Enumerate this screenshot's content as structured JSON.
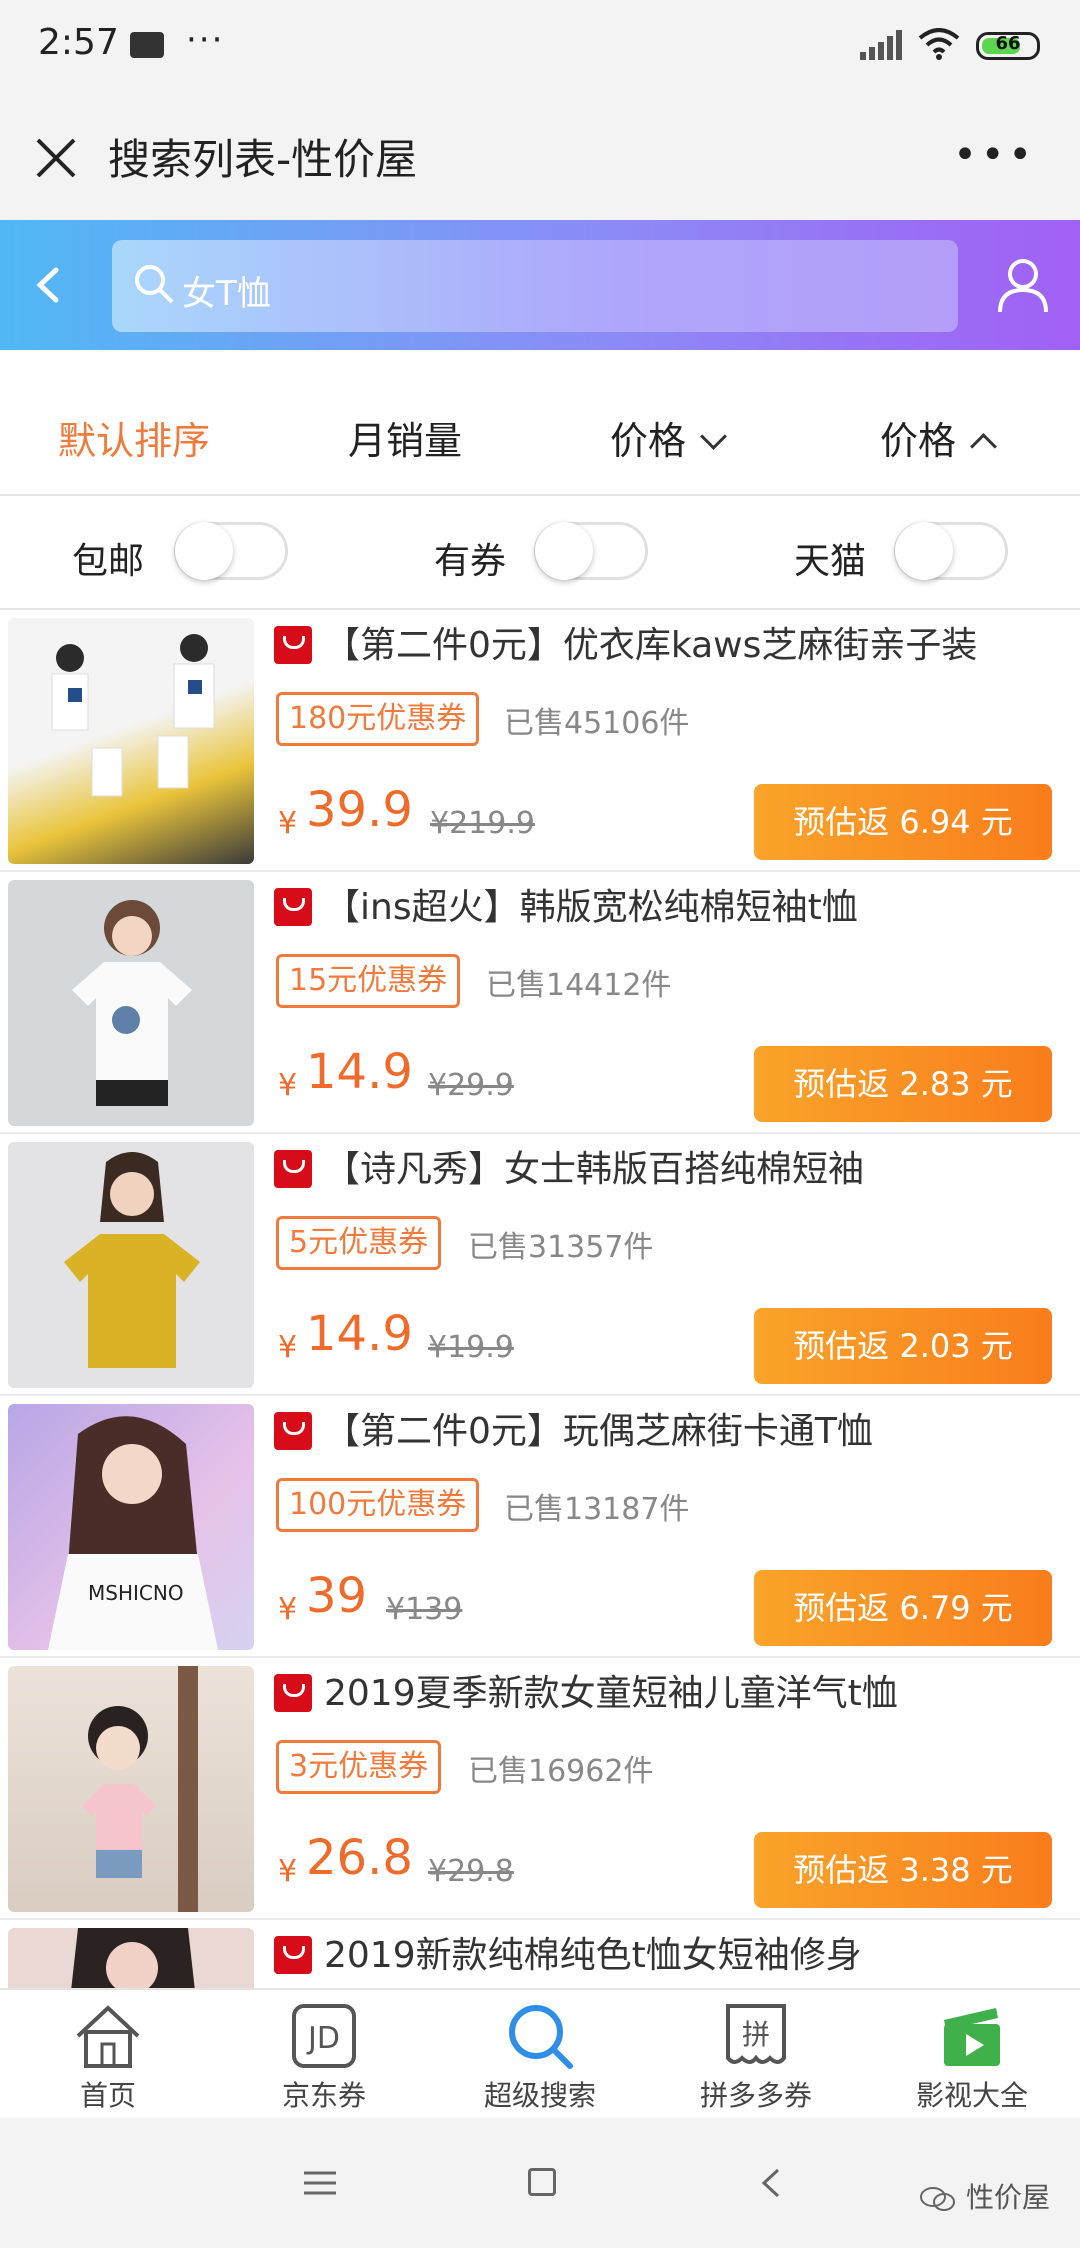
{
  "status": {
    "time": "2:57",
    "battery": "66"
  },
  "titlebar": {
    "title": "搜索列表-性价屋"
  },
  "search": {
    "query": "女T恤"
  },
  "sort": {
    "default": "默认排序",
    "sales": "月销量",
    "price_desc": "价格",
    "price_asc": "价格"
  },
  "filters": {
    "free_shipping": "包邮",
    "has_coupon": "有券",
    "tmall": "天猫"
  },
  "products": [
    {
      "title": "【第二件0元】优衣库kaws芝麻街亲子装",
      "coupon": "180元优惠券",
      "sold": "已售45106件",
      "currency": "¥",
      "price": "39.9",
      "original_price": "¥219.9",
      "rebate": "预估返 6.94 元",
      "thumb_color": "#e9c43a"
    },
    {
      "title": "【ins超火】韩版宽松纯棉短袖t恤",
      "coupon": "15元优惠券",
      "sold": "已售14412件",
      "currency": "¥",
      "price": "14.9",
      "original_price": "¥29.9",
      "rebate": "预估返 2.83 元",
      "thumb_color": "#cfd3d6"
    },
    {
      "title": "【诗凡秀】女士韩版百搭纯棉短袖",
      "coupon": "5元优惠券",
      "sold": "已售31357件",
      "currency": "¥",
      "price": "14.9",
      "original_price": "¥19.9",
      "rebate": "预估返 2.03 元",
      "thumb_color": "#d7b72a"
    },
    {
      "title": "【第二件0元】玩偶芝麻街卡通T恤",
      "coupon": "100元优惠券",
      "sold": "已售13187件",
      "currency": "¥",
      "price": "39",
      "original_price": "¥139",
      "rebate": "预估返 6.79 元",
      "thumb_color": "#c6b8e8"
    },
    {
      "title": "2019夏季新款女童短袖儿童洋气t恤",
      "coupon": "3元优惠券",
      "sold": "已售16962件",
      "currency": "¥",
      "price": "26.8",
      "original_price": "¥29.8",
      "rebate": "预估返 3.38 元",
      "thumb_color": "#e6d7cc"
    },
    {
      "title": "2019新款纯棉纯色t恤女短袖修身",
      "coupon": "",
      "sold": "",
      "currency": "",
      "price": "",
      "original_price": "",
      "rebate": "",
      "thumb_color": "#d9b8b0"
    }
  ],
  "bottom_nav": [
    {
      "label": "首页",
      "icon": "home-icon"
    },
    {
      "label": "京东券",
      "icon": "jd-icon"
    },
    {
      "label": "超级搜索",
      "icon": "search-icon"
    },
    {
      "label": "拼多多券",
      "icon": "pinduoduo-icon"
    },
    {
      "label": "影视大全",
      "icon": "movie-icon"
    }
  ],
  "watermark": "性价屋"
}
